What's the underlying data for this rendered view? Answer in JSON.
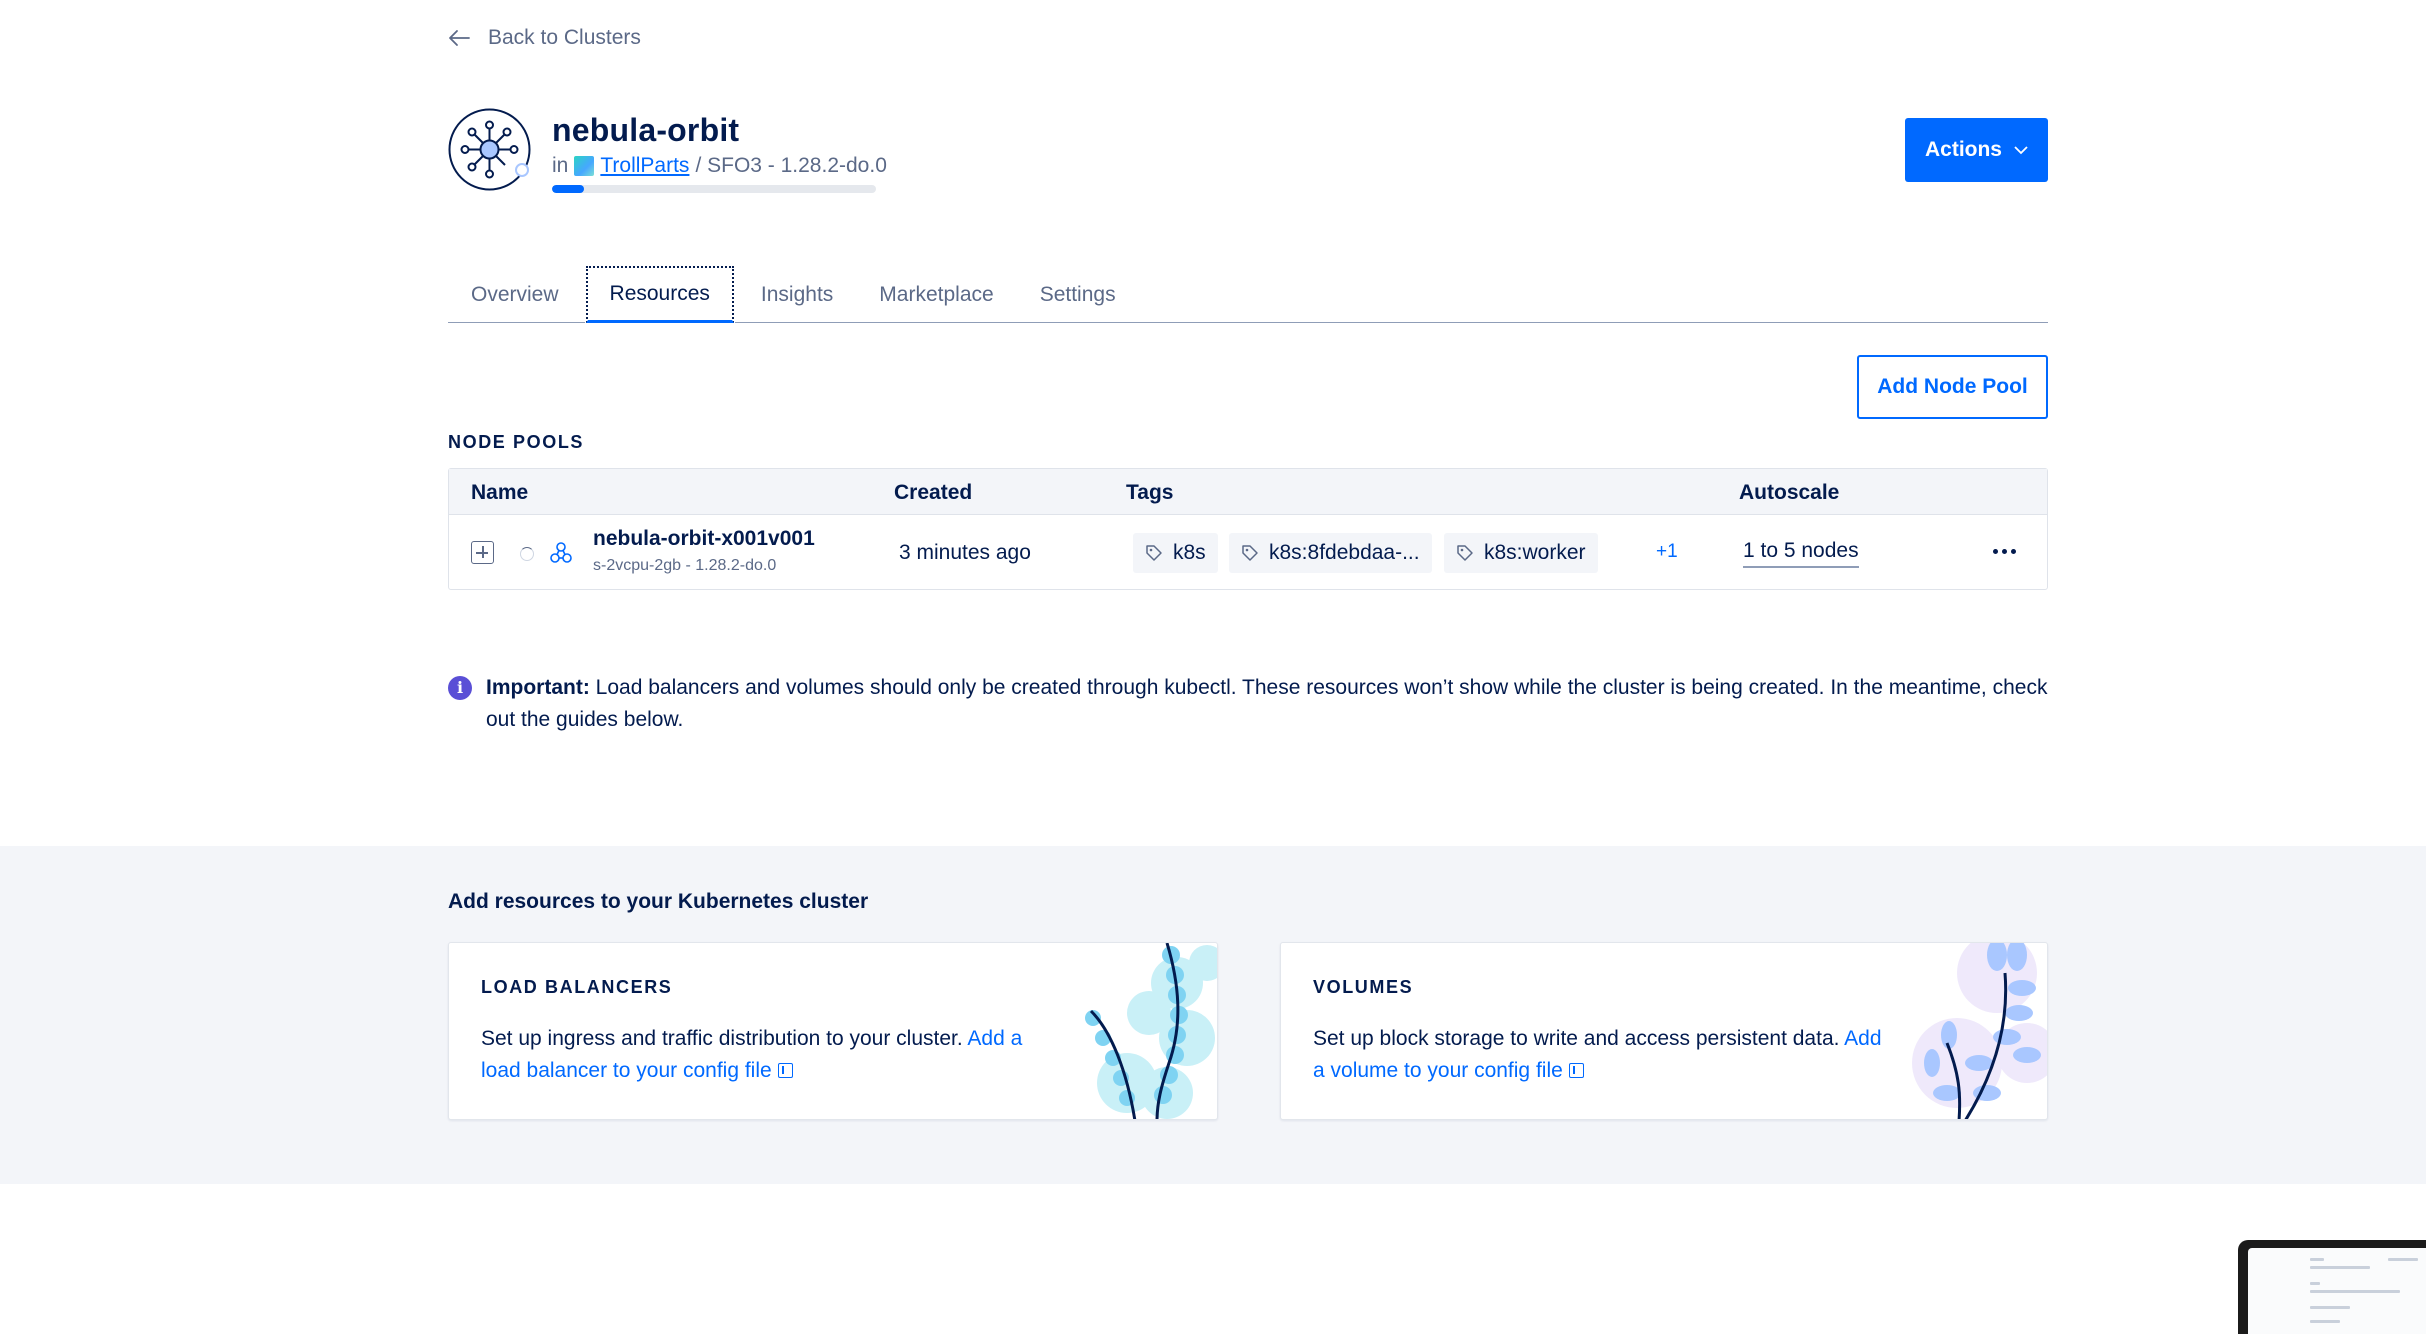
{
  "nav": {
    "back_label": "Back to Clusters"
  },
  "cluster": {
    "name": "nebula-orbit",
    "in_label": "in",
    "project": "TrollParts",
    "region_version": "/ SFO3 - 1.28.2-do.0",
    "progress_fraction": 0.1
  },
  "header": {
    "actions_label": "Actions"
  },
  "tabs": [
    {
      "label": "Overview",
      "active": false
    },
    {
      "label": "Resources",
      "active": true
    },
    {
      "label": "Insights",
      "active": false
    },
    {
      "label": "Marketplace",
      "active": false
    },
    {
      "label": "Settings",
      "active": false
    }
  ],
  "node_pools": {
    "add_button": "Add Node Pool",
    "section_label": "NODE POOLS",
    "columns": {
      "name": "Name",
      "created": "Created",
      "tags": "Tags",
      "autoscale": "Autoscale"
    },
    "rows": [
      {
        "name": "nebula-orbit-x001v001",
        "spec": "s-2vcpu-2gb - 1.28.2-do.0",
        "created": "3 minutes ago",
        "tags": [
          "k8s",
          "k8s:8fdebdaa-...",
          "k8s:worker"
        ],
        "more_tags": "+1",
        "autoscale": "1 to 5 nodes"
      }
    ]
  },
  "notice": {
    "strong": "Important:",
    "text": "Load balancers and volumes should only be created through kubectl. These resources won’t show while the cluster is being created. In the meantime, check out the guides below."
  },
  "resources": {
    "title": "Add resources to your Kubernetes cluster",
    "load_balancers": {
      "heading": "LOAD BALANCERS",
      "text": "Set up ingress and traffic distribution to your cluster.",
      "link": "Add a load balancer to your config file"
    },
    "volumes": {
      "heading": "VOLUMES",
      "text": "Set up block storage to write and access persistent data.",
      "link": "Add a volume to your config file"
    }
  },
  "colors": {
    "primary": "#0069ff",
    "text": "#031b4e",
    "muted": "#5b6987",
    "band": "#f3f5f9"
  }
}
